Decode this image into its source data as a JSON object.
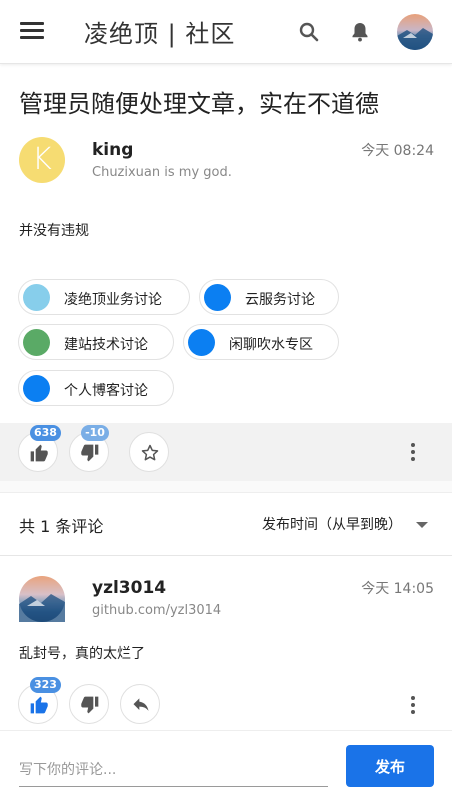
{
  "header": {
    "title": "凌绝顶 | 社区",
    "menu_icon": "menu-icon",
    "search_icon": "search-icon",
    "notification_icon": "bell-icon",
    "avatar_icon": "user-avatar"
  },
  "post": {
    "title": "管理员随便处理文章，实在不道德",
    "author": {
      "initial": "K",
      "name": "king",
      "signature": "Chuzixuan is my god.",
      "avatar_color": "#f6dc72"
    },
    "time": "今天 08:24",
    "body": "并没有违规",
    "tags": [
      {
        "label": "凌绝顶业务讨论",
        "color": "#87ceeb"
      },
      {
        "label": "云服务讨论",
        "color": "#0b7ff2"
      },
      {
        "label": "建站技术讨论",
        "color": "#5aaa66"
      },
      {
        "label": "闲聊吹水专区",
        "color": "#0b7ff2"
      },
      {
        "label": "个人博客讨论",
        "color": "#0b7ff2"
      }
    ],
    "likes": "638",
    "dislikes": "-10",
    "like_badge_color": "#4a90e2",
    "dislike_badge_color": "#7aaee6"
  },
  "comments_section": {
    "count_label": "共 1 条评论",
    "sort_label": "发布时间（从早到晚）"
  },
  "comment": {
    "name": "yzl3014",
    "link": "github.com/yzl3014",
    "time": "今天 14:05",
    "body": "乱封号，真的太烂了",
    "likes": "323"
  },
  "composer": {
    "placeholder": "写下你的评论...",
    "submit_label": "发布",
    "accent": "#1a73e8"
  }
}
